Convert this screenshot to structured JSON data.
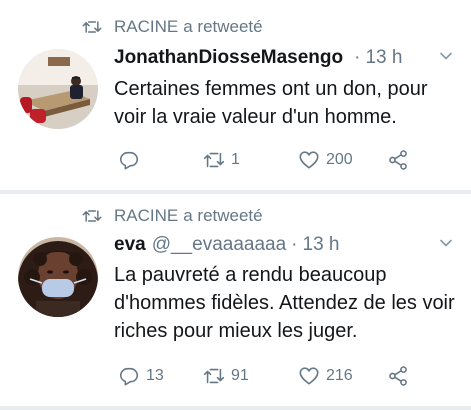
{
  "colors": {
    "text": "#14171a",
    "muted": "#657786",
    "divider": "#e6ecf0"
  },
  "tweets": [
    {
      "retweeter_name": "RACINE",
      "retweet_label": "a retweeté",
      "name": "JonathanDiosseMasengo",
      "handle": "",
      "separator": "·",
      "time": "13 h",
      "text": "Certaines femmes ont un don, pour voir la vraie valeur d'un homme.",
      "avatar_icon": "office-photo-avatar",
      "reply_count": "",
      "retweet_count": "1",
      "like_count": "200"
    },
    {
      "retweeter_name": "RACINE",
      "retweet_label": "a retweeté",
      "name": "eva",
      "handle": "@__evaaaaaaa",
      "separator": "·",
      "time": "13 h",
      "text": "La pauvreté a rendu beaucoup d'hommes fidèles. Attendez de les voir riches pour mieux les juger.",
      "avatar_icon": "masked-woman-avatar",
      "reply_count": "13",
      "retweet_count": "91",
      "like_count": "216"
    }
  ]
}
